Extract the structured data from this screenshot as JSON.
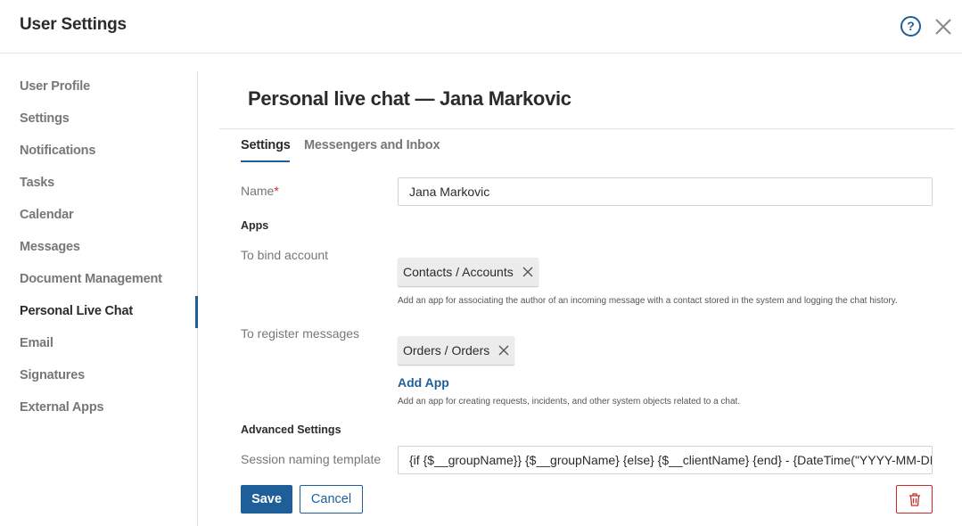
{
  "window": {
    "title": "User Settings"
  },
  "sidebar": {
    "items": [
      {
        "label": "User Profile"
      },
      {
        "label": "Settings"
      },
      {
        "label": "Notifications"
      },
      {
        "label": "Tasks"
      },
      {
        "label": "Calendar"
      },
      {
        "label": "Messages"
      },
      {
        "label": "Document Management"
      },
      {
        "label": "Personal Live Chat",
        "active": true
      },
      {
        "label": "Email"
      },
      {
        "label": "Signatures"
      },
      {
        "label": "External Apps"
      }
    ]
  },
  "main": {
    "title": "Personal live chat — Jana Markovic",
    "tabs": [
      {
        "label": "Settings",
        "active": true
      },
      {
        "label": "Messengers and Inbox"
      }
    ],
    "form": {
      "name_label": "Name",
      "name_required_mark": "*",
      "name_value": "Jana Markovic",
      "apps_heading": "Apps",
      "bind_account_label": "To bind account",
      "bind_account_chip": "Contacts / Accounts",
      "bind_account_hint": "Add an app for associating the author of an incoming message with a contact stored in the system and logging the chat history.",
      "register_messages_label": "To register messages",
      "register_messages_chip": "Orders / Orders",
      "add_app_label": "Add App",
      "register_messages_hint": "Add an app for creating requests, incidents, and other system objects related to a chat.",
      "advanced_heading": "Advanced Settings",
      "session_template_label": "Session naming template",
      "session_template_value": "{if {$__groupName}} {$__groupName} {else} {$__clientName} {end} - {DateTime(\"YYYY-MM-DD\"...)"
    },
    "buttons": {
      "save": "Save",
      "cancel": "Cancel"
    }
  },
  "icons": {
    "help": "help-circle-icon",
    "close": "close-icon",
    "chip_remove": "x-icon",
    "delete": "trash-icon"
  },
  "colors": {
    "accent": "#1f5f99",
    "danger": "#cc2b2b",
    "required": "#d0262c"
  }
}
